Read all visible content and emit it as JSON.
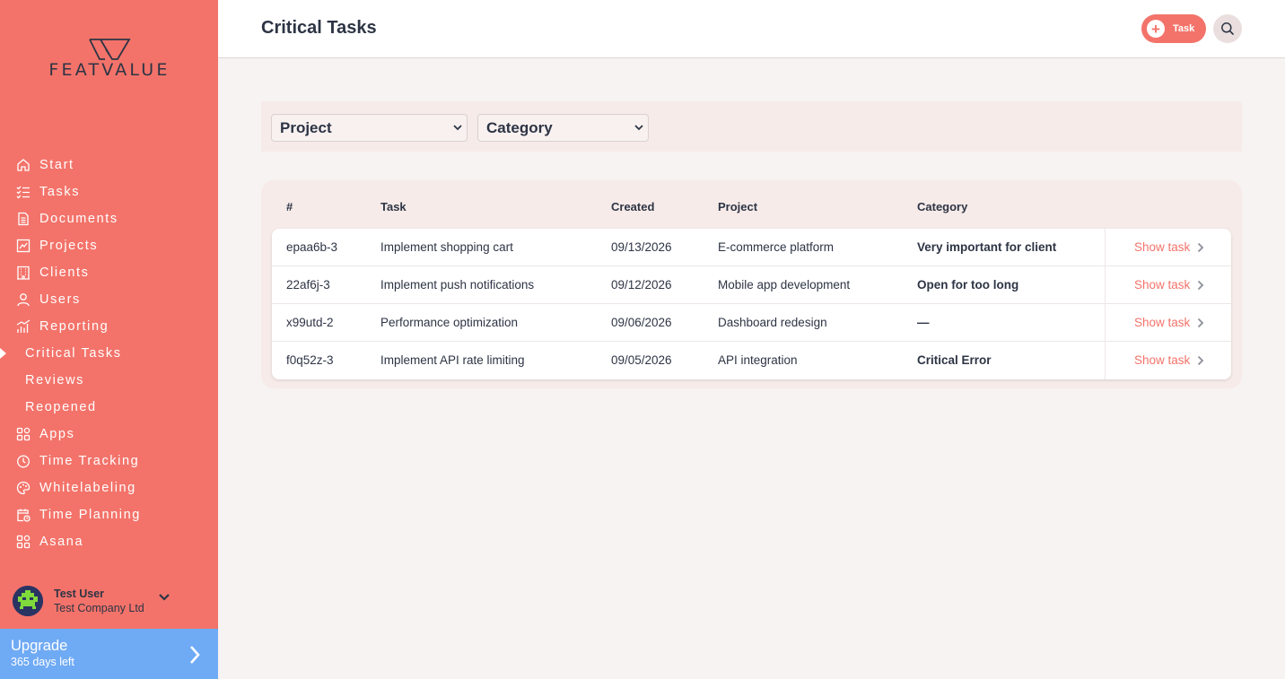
{
  "brand": {
    "name": "FEATVALUE"
  },
  "sidebar": {
    "items": [
      {
        "label": "Start",
        "icon": "home-icon"
      },
      {
        "label": "Tasks",
        "icon": "checklist-icon"
      },
      {
        "label": "Documents",
        "icon": "document-icon"
      },
      {
        "label": "Projects",
        "icon": "chart-board-icon"
      },
      {
        "label": "Clients",
        "icon": "building-icon"
      },
      {
        "label": "Users",
        "icon": "user-icon"
      },
      {
        "label": "Reporting",
        "icon": "bar-chart-icon"
      },
      {
        "label": "Critical Tasks",
        "sub": true,
        "active": true
      },
      {
        "label": "Reviews",
        "sub": true
      },
      {
        "label": "Reopened",
        "sub": true
      },
      {
        "label": "Apps",
        "icon": "apps-grid-icon"
      },
      {
        "label": "Time Tracking",
        "icon": "timer-icon"
      },
      {
        "label": "Whitelabeling",
        "icon": "palette-icon"
      },
      {
        "label": "Time Planning",
        "icon": "calendar-clock-icon"
      },
      {
        "label": "Asana",
        "icon": "apps-grid-icon"
      }
    ]
  },
  "user": {
    "name": "Test User",
    "company": "Test Company Ltd"
  },
  "upgrade": {
    "title": "Upgrade",
    "subtitle": "365 days left"
  },
  "header": {
    "title": "Critical Tasks",
    "add_task_label": "Task"
  },
  "filters": {
    "project": "Project",
    "category": "Category"
  },
  "table": {
    "columns": [
      "#",
      "Task",
      "Created",
      "Project",
      "Category"
    ],
    "action_label": "Show task",
    "rows": [
      {
        "id": "epaa6b-3",
        "task": "Implement shopping cart",
        "created": "09/13/2026",
        "project": "E-commerce platform",
        "category": "Very important for client"
      },
      {
        "id": "22af6j-3",
        "task": "Implement push notifications",
        "created": "09/12/2026",
        "project": "Mobile app development",
        "category": "Open for too long"
      },
      {
        "id": "x99utd-2",
        "task": "Performance optimization",
        "created": "09/06/2026",
        "project": "Dashboard redesign",
        "category": "—"
      },
      {
        "id": "f0q52z-3",
        "task": "Implement API rate limiting",
        "created": "09/05/2026",
        "project": "API integration",
        "category": "Critical Error"
      }
    ]
  },
  "colors": {
    "brand": "#f3736a",
    "upgrade": "#6faaf5",
    "text": "#2d3444",
    "background": "#f7f3f2"
  }
}
